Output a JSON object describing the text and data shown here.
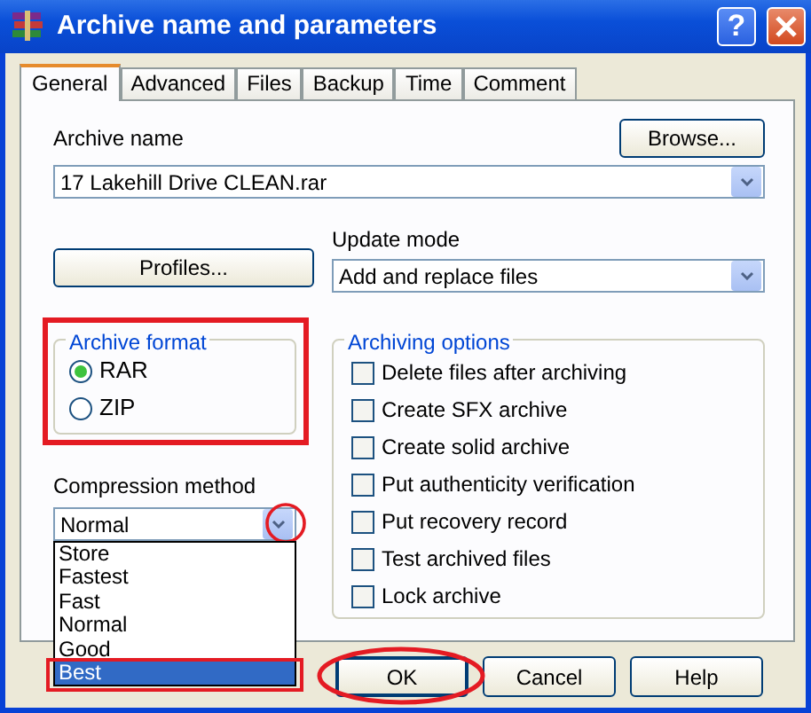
{
  "window": {
    "title": "Archive name and parameters",
    "help_button": "?"
  },
  "tabs": [
    {
      "label": "General",
      "selected": true
    },
    {
      "label": "Advanced",
      "selected": false
    },
    {
      "label": "Files",
      "selected": false
    },
    {
      "label": "Backup",
      "selected": false
    },
    {
      "label": "Time",
      "selected": false
    },
    {
      "label": "Comment",
      "selected": false
    }
  ],
  "archive_name": {
    "label": "Archive name",
    "value": "17 Lakehill Drive CLEAN.rar",
    "browse_button": "Browse..."
  },
  "profiles_button": "Profiles...",
  "update_mode": {
    "label": "Update mode",
    "value": "Add and replace files"
  },
  "archive_format": {
    "title": "Archive format",
    "options": [
      {
        "label": "RAR",
        "selected": true
      },
      {
        "label": "ZIP",
        "selected": false
      }
    ]
  },
  "compression_method": {
    "label": "Compression method",
    "value": "Normal",
    "expanded": true,
    "options": [
      {
        "label": "Store",
        "highlighted": false
      },
      {
        "label": "Fastest",
        "highlighted": false
      },
      {
        "label": "Fast",
        "highlighted": false
      },
      {
        "label": "Normal",
        "highlighted": false
      },
      {
        "label": "Good",
        "highlighted": false
      },
      {
        "label": "Best",
        "highlighted": true
      }
    ]
  },
  "archiving_options": {
    "title": "Archiving options",
    "items": [
      {
        "label": "Delete files after archiving",
        "checked": false
      },
      {
        "label": "Create SFX archive",
        "checked": false
      },
      {
        "label": "Create solid archive",
        "checked": false
      },
      {
        "label": "Put authenticity verification",
        "checked": false
      },
      {
        "label": "Put recovery record",
        "checked": false
      },
      {
        "label": "Test archived files",
        "checked": false
      },
      {
        "label": "Lock archive",
        "checked": false
      }
    ]
  },
  "buttons": [
    {
      "label": "OK",
      "default": true
    },
    {
      "label": "Cancel",
      "default": false
    },
    {
      "label": "Help",
      "default": false
    }
  ]
}
